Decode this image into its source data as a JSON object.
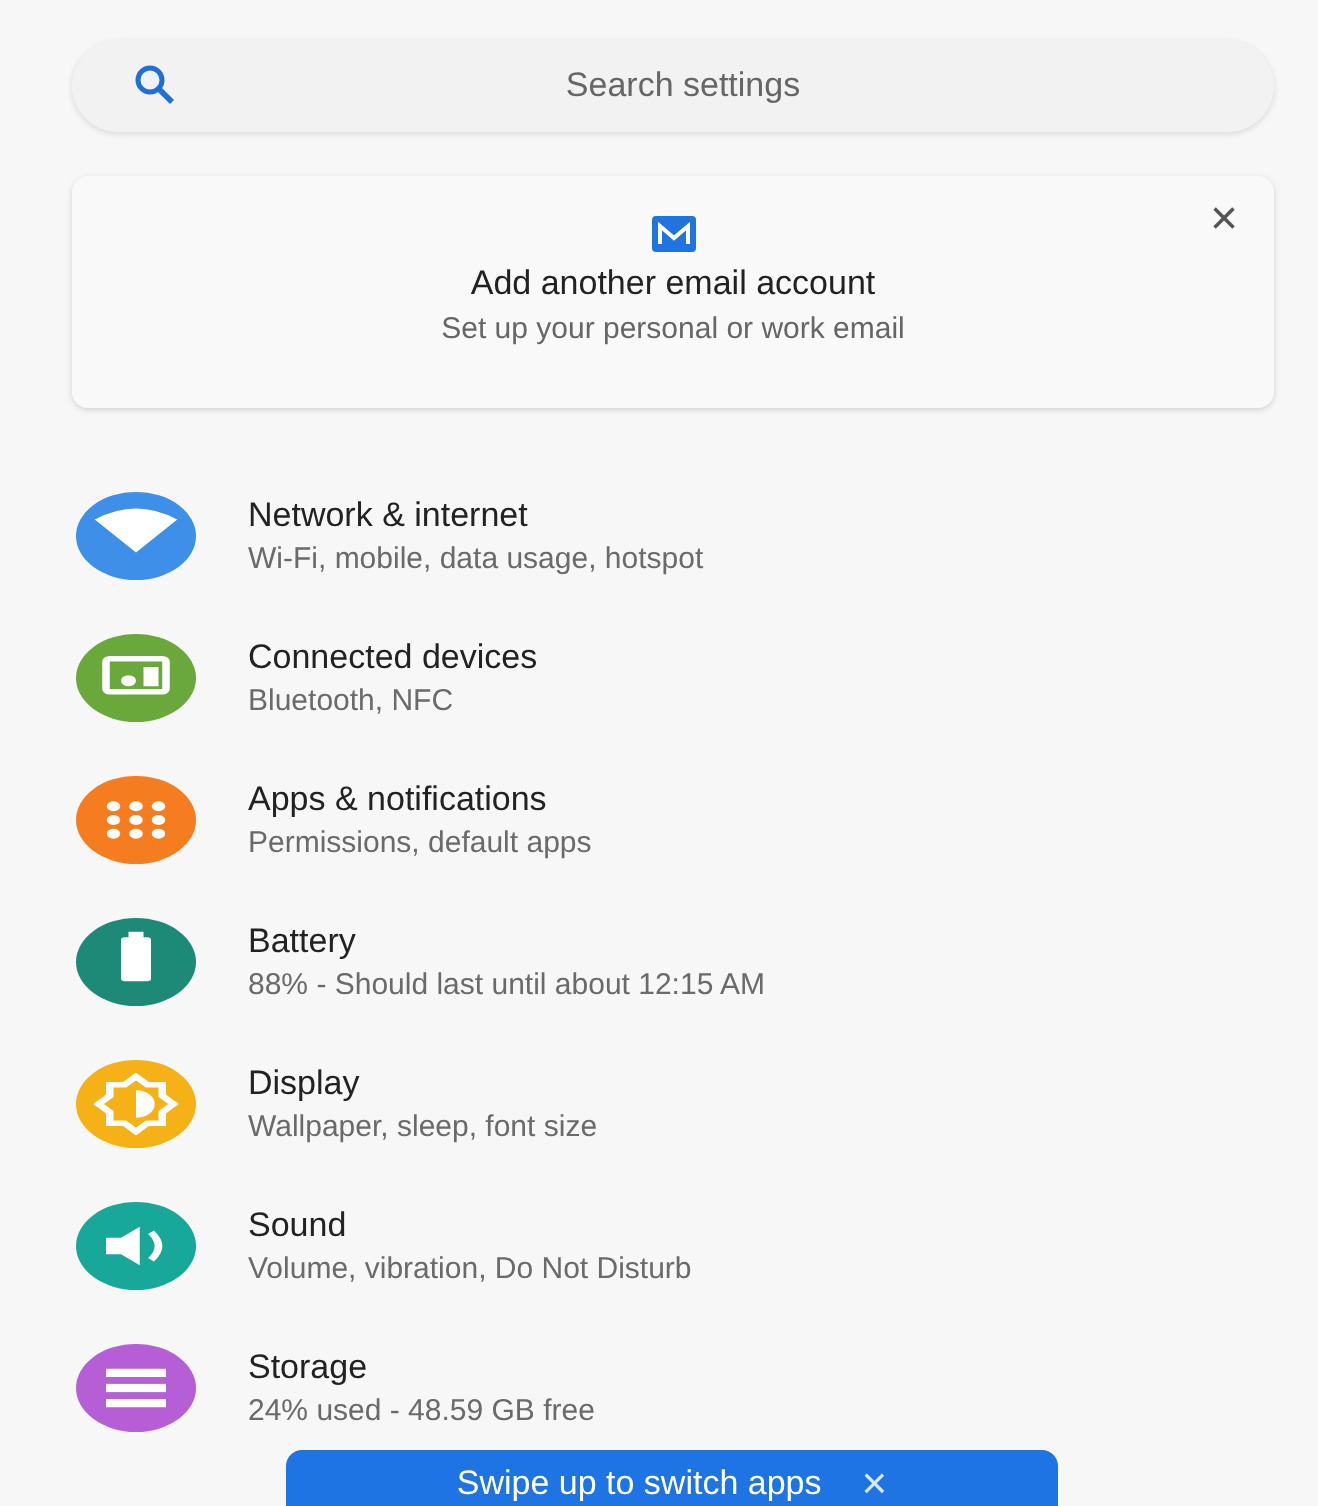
{
  "search": {
    "placeholder": "Search settings"
  },
  "suggestion_card": {
    "close": "×",
    "title": "Add another email account",
    "subtitle": "Set up your personal or work email"
  },
  "items": [
    {
      "kind": "wifi",
      "color": "#3d8fe8",
      "title": "Network & internet",
      "subtitle": "Wi-Fi, mobile, data usage, hotspot"
    },
    {
      "kind": "devices",
      "color": "#6aa83b",
      "title": "Connected devices",
      "subtitle": "Bluetooth, NFC"
    },
    {
      "kind": "apps",
      "color": "#f57c1f",
      "title": "Apps & notifications",
      "subtitle": "Permissions, default apps"
    },
    {
      "kind": "battery",
      "color": "#1d8a78",
      "title": "Battery",
      "subtitle": "88% - Should last until about 12:15 AM"
    },
    {
      "kind": "display",
      "color": "#f5b115",
      "title": "Display",
      "subtitle": "Wallpaper, sleep, font size"
    },
    {
      "kind": "sound",
      "color": "#17a89a",
      "title": "Sound",
      "subtitle": "Volume, vibration, Do Not Disturb"
    },
    {
      "kind": "storage",
      "color": "#b55ed6",
      "title": "Storage",
      "subtitle": "24% used - 48.59 GB free"
    }
  ],
  "toast": {
    "text": "Swipe up to switch apps",
    "close": "×"
  }
}
